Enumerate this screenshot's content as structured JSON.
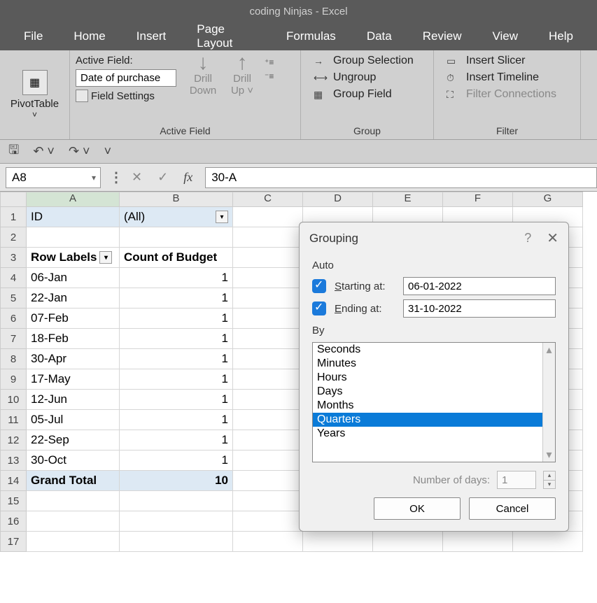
{
  "title": "coding Ninjas  -  Excel",
  "menu": [
    "File",
    "Home",
    "Insert",
    "Page Layout",
    "Formulas",
    "Data",
    "Review",
    "View",
    "Help"
  ],
  "ribbon": {
    "pivottable": "PivotTable",
    "active_field_label": "Active Field:",
    "active_field_value": "Date of purchase",
    "field_settings": "Field Settings",
    "drill_down": "Drill\nDown",
    "drill_up": "Drill\nUp",
    "group_label_active": "Active Field",
    "group_selection": "Group Selection",
    "ungroup": "Ungroup",
    "group_field": "Group Field",
    "group_label_group": "Group",
    "insert_slicer": "Insert Slicer",
    "insert_timeline": "Insert Timeline",
    "filter_connections": "Filter Connections",
    "group_label_filter": "Filter"
  },
  "namebox": "A8",
  "formula": "30-A",
  "columns": [
    "A",
    "B",
    "C",
    "D",
    "E",
    "F",
    "G"
  ],
  "rows": [
    {
      "n": "1",
      "a": "ID",
      "b": "(All)",
      "head": true,
      "dd": true
    },
    {
      "n": "2",
      "a": "",
      "b": ""
    },
    {
      "n": "3",
      "a": "Row Labels",
      "b": "Count of Budget",
      "bold": true,
      "ddA": true
    },
    {
      "n": "4",
      "a": "06-Jan",
      "b": "1"
    },
    {
      "n": "5",
      "a": "22-Jan",
      "b": "1"
    },
    {
      "n": "6",
      "a": "07-Feb",
      "b": "1"
    },
    {
      "n": "7",
      "a": "18-Feb",
      "b": "1"
    },
    {
      "n": "8",
      "a": "30-Apr",
      "b": "1"
    },
    {
      "n": "9",
      "a": "17-May",
      "b": "1"
    },
    {
      "n": "10",
      "a": "12-Jun",
      "b": "1"
    },
    {
      "n": "11",
      "a": "05-Jul",
      "b": "1"
    },
    {
      "n": "12",
      "a": "22-Sep",
      "b": "1"
    },
    {
      "n": "13",
      "a": "30-Oct",
      "b": "1"
    },
    {
      "n": "14",
      "a": "Grand Total",
      "b": "10",
      "total": true
    },
    {
      "n": "15",
      "a": "",
      "b": ""
    },
    {
      "n": "16",
      "a": "",
      "b": ""
    },
    {
      "n": "17",
      "a": "",
      "b": ""
    }
  ],
  "dialog": {
    "title": "Grouping",
    "auto": "Auto",
    "starting_label": "Starting at:",
    "starting_value": "06-01-2022",
    "ending_label": "Ending at:",
    "ending_value": "31-10-2022",
    "by_label": "By",
    "by_items": [
      "Seconds",
      "Minutes",
      "Hours",
      "Days",
      "Months",
      "Quarters",
      "Years"
    ],
    "by_selected": "Quarters",
    "numdays_label": "Number of days:",
    "numdays_value": "1",
    "ok": "OK",
    "cancel": "Cancel"
  }
}
